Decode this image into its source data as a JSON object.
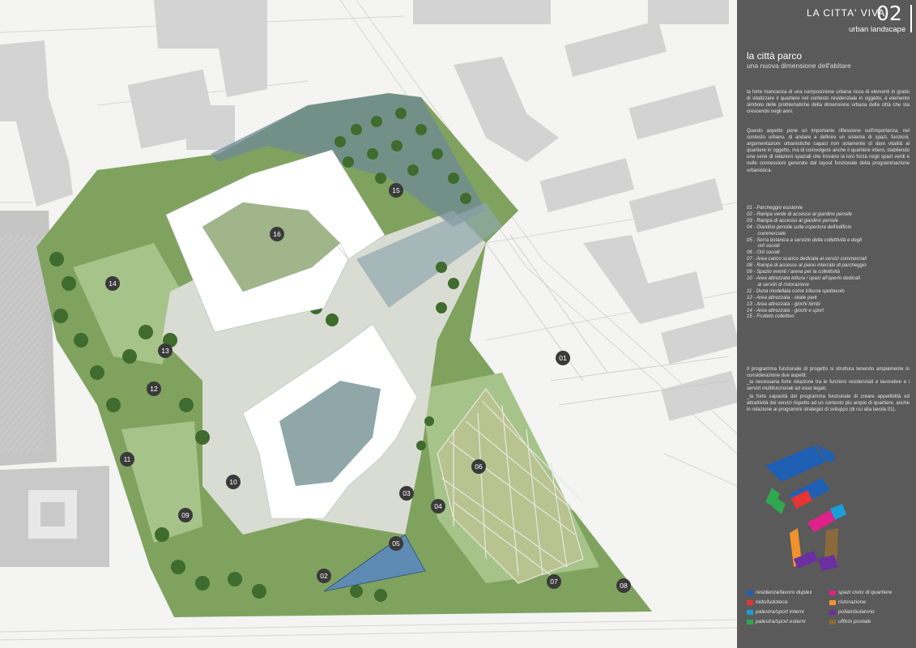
{
  "header": {
    "title": "LA CITTA' VIVA",
    "number": "02",
    "subtitle": "urban landscape"
  },
  "section": {
    "title": "la città parco",
    "subtitle": "una nuova dimensione dell'abitare"
  },
  "paragraphs": [
    "la forte mancanza di una composizione urbana ricca di elementi in grado di vitalizzare il quartiere nel contesto residenziale in oggetto, è elemento simbolo delle problematiche della dimensione urbana della città che sta crescendo negli anni.",
    "Questo aspetto pone un importante riflessione sull'importanza, nel contesto urbano, di andare a definire un sistema di spazi, funzioni, argomentazioni urbanistiche capaci non solamente di dare vitalità al quartiere in oggetto, ma di coinvolgere anche il quartiere intero, stabilendo una serie di relazioni spaziali che trovano la loro forza negli spazi verdi e nelle connessioni generate dal layout funzionale della programmazione urbanistica.",
    "Il programma funzionale di progetto si struttura tenendo ampiamente in considerazione due aspetti:",
    "_la necessaria forte relazione tra le funzioni residenziali e lavorative e i servizi multifunzionali ad esse legati;",
    "_la forte capacità del programma funzionale di creare appetibilità ed attrattività dei servizi rispetto ad un contesto più ampio di quartiere, anche in relazione ai programmi strategici di sviluppo (di cui alla tavola 01)."
  ],
  "legend": [
    "01 - Parcheggio esistente",
    "02 - Rampa verde di accesso al giardino pensile",
    "03 - Rampa di accesso al giardino pensile",
    "04 - Giardino pensile sulla copertura dell'edificio",
    "        commerciale",
    "05 - Serra botanica a servizio della collettività e degli",
    "        orti sociali",
    "06 - Orti sociali",
    "07 - Area carico scarico dedicata ai servizi commerciali",
    "08 - Rampa di accesso al piano interrato di parcheggio",
    "09 - Spazio eventi / arena per la collettività",
    "10 - Area attrezzata lettura / spazi all'aperto dedicati",
    "        ai servizi di ristorazione",
    "11 - Duna modellata come tribuna spettacolo",
    "12 - Area attrezzata - skate park",
    "13 - Area attrezzata - giochi bimbi",
    "14 - Area attrezzata - giochi e sport",
    "15 - Frutteto collettivo"
  ],
  "function_key": [
    {
      "label": "residenza/lavoro duplex",
      "color": "#1f5fb4"
    },
    {
      "label": "spazi civici di quartiere",
      "color": "#e0218a"
    },
    {
      "label": "nido/ludoteca",
      "color": "#e53535"
    },
    {
      "label": "ristorazione",
      "color": "#f0932b"
    },
    {
      "label": "palestra/sport interni",
      "color": "#1aa0d8"
    },
    {
      "label": "poliambulatorio",
      "color": "#6a2fa0"
    },
    {
      "label": "palestra/sport esterni",
      "color": "#2fa84f"
    },
    {
      "label": "ufficio postale",
      "color": "#8a6a3a"
    }
  ],
  "markers": [
    "01",
    "02",
    "03",
    "04",
    "05",
    "06",
    "07",
    "08",
    "09",
    "10",
    "11",
    "12",
    "13",
    "14",
    "15",
    "16"
  ]
}
